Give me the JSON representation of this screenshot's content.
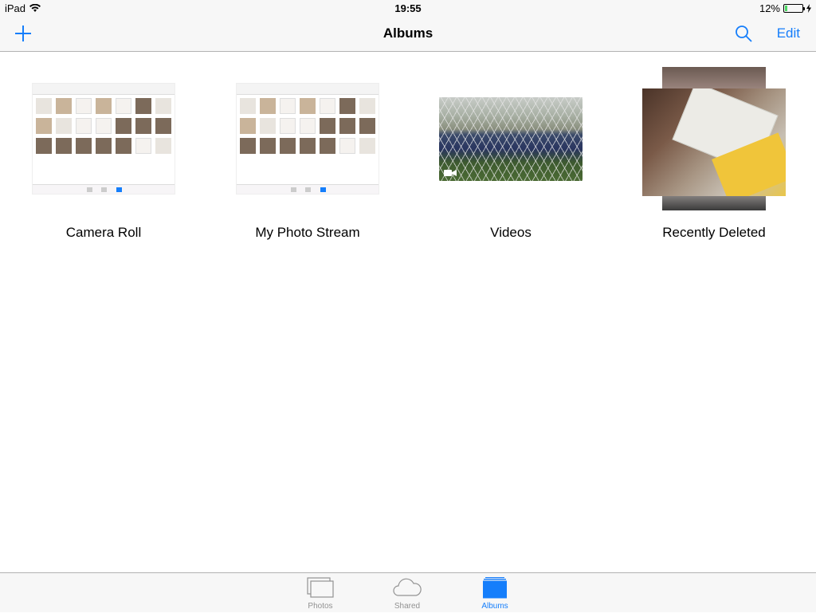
{
  "status_bar": {
    "device": "iPad",
    "time": "19:55",
    "battery_percent": "12%",
    "battery_level": 0.12
  },
  "nav": {
    "title": "Albums",
    "edit_label": "Edit"
  },
  "albums": [
    {
      "name": "Camera Roll"
    },
    {
      "name": "My Photo Stream"
    },
    {
      "name": "Videos"
    },
    {
      "name": "Recently Deleted"
    }
  ],
  "tab_bar": {
    "tabs": [
      {
        "label": "Photos"
      },
      {
        "label": "Shared"
      },
      {
        "label": "Albums"
      }
    ],
    "active": "Albums"
  },
  "colors": {
    "accent": "#157efb",
    "inactive": "#929292"
  }
}
